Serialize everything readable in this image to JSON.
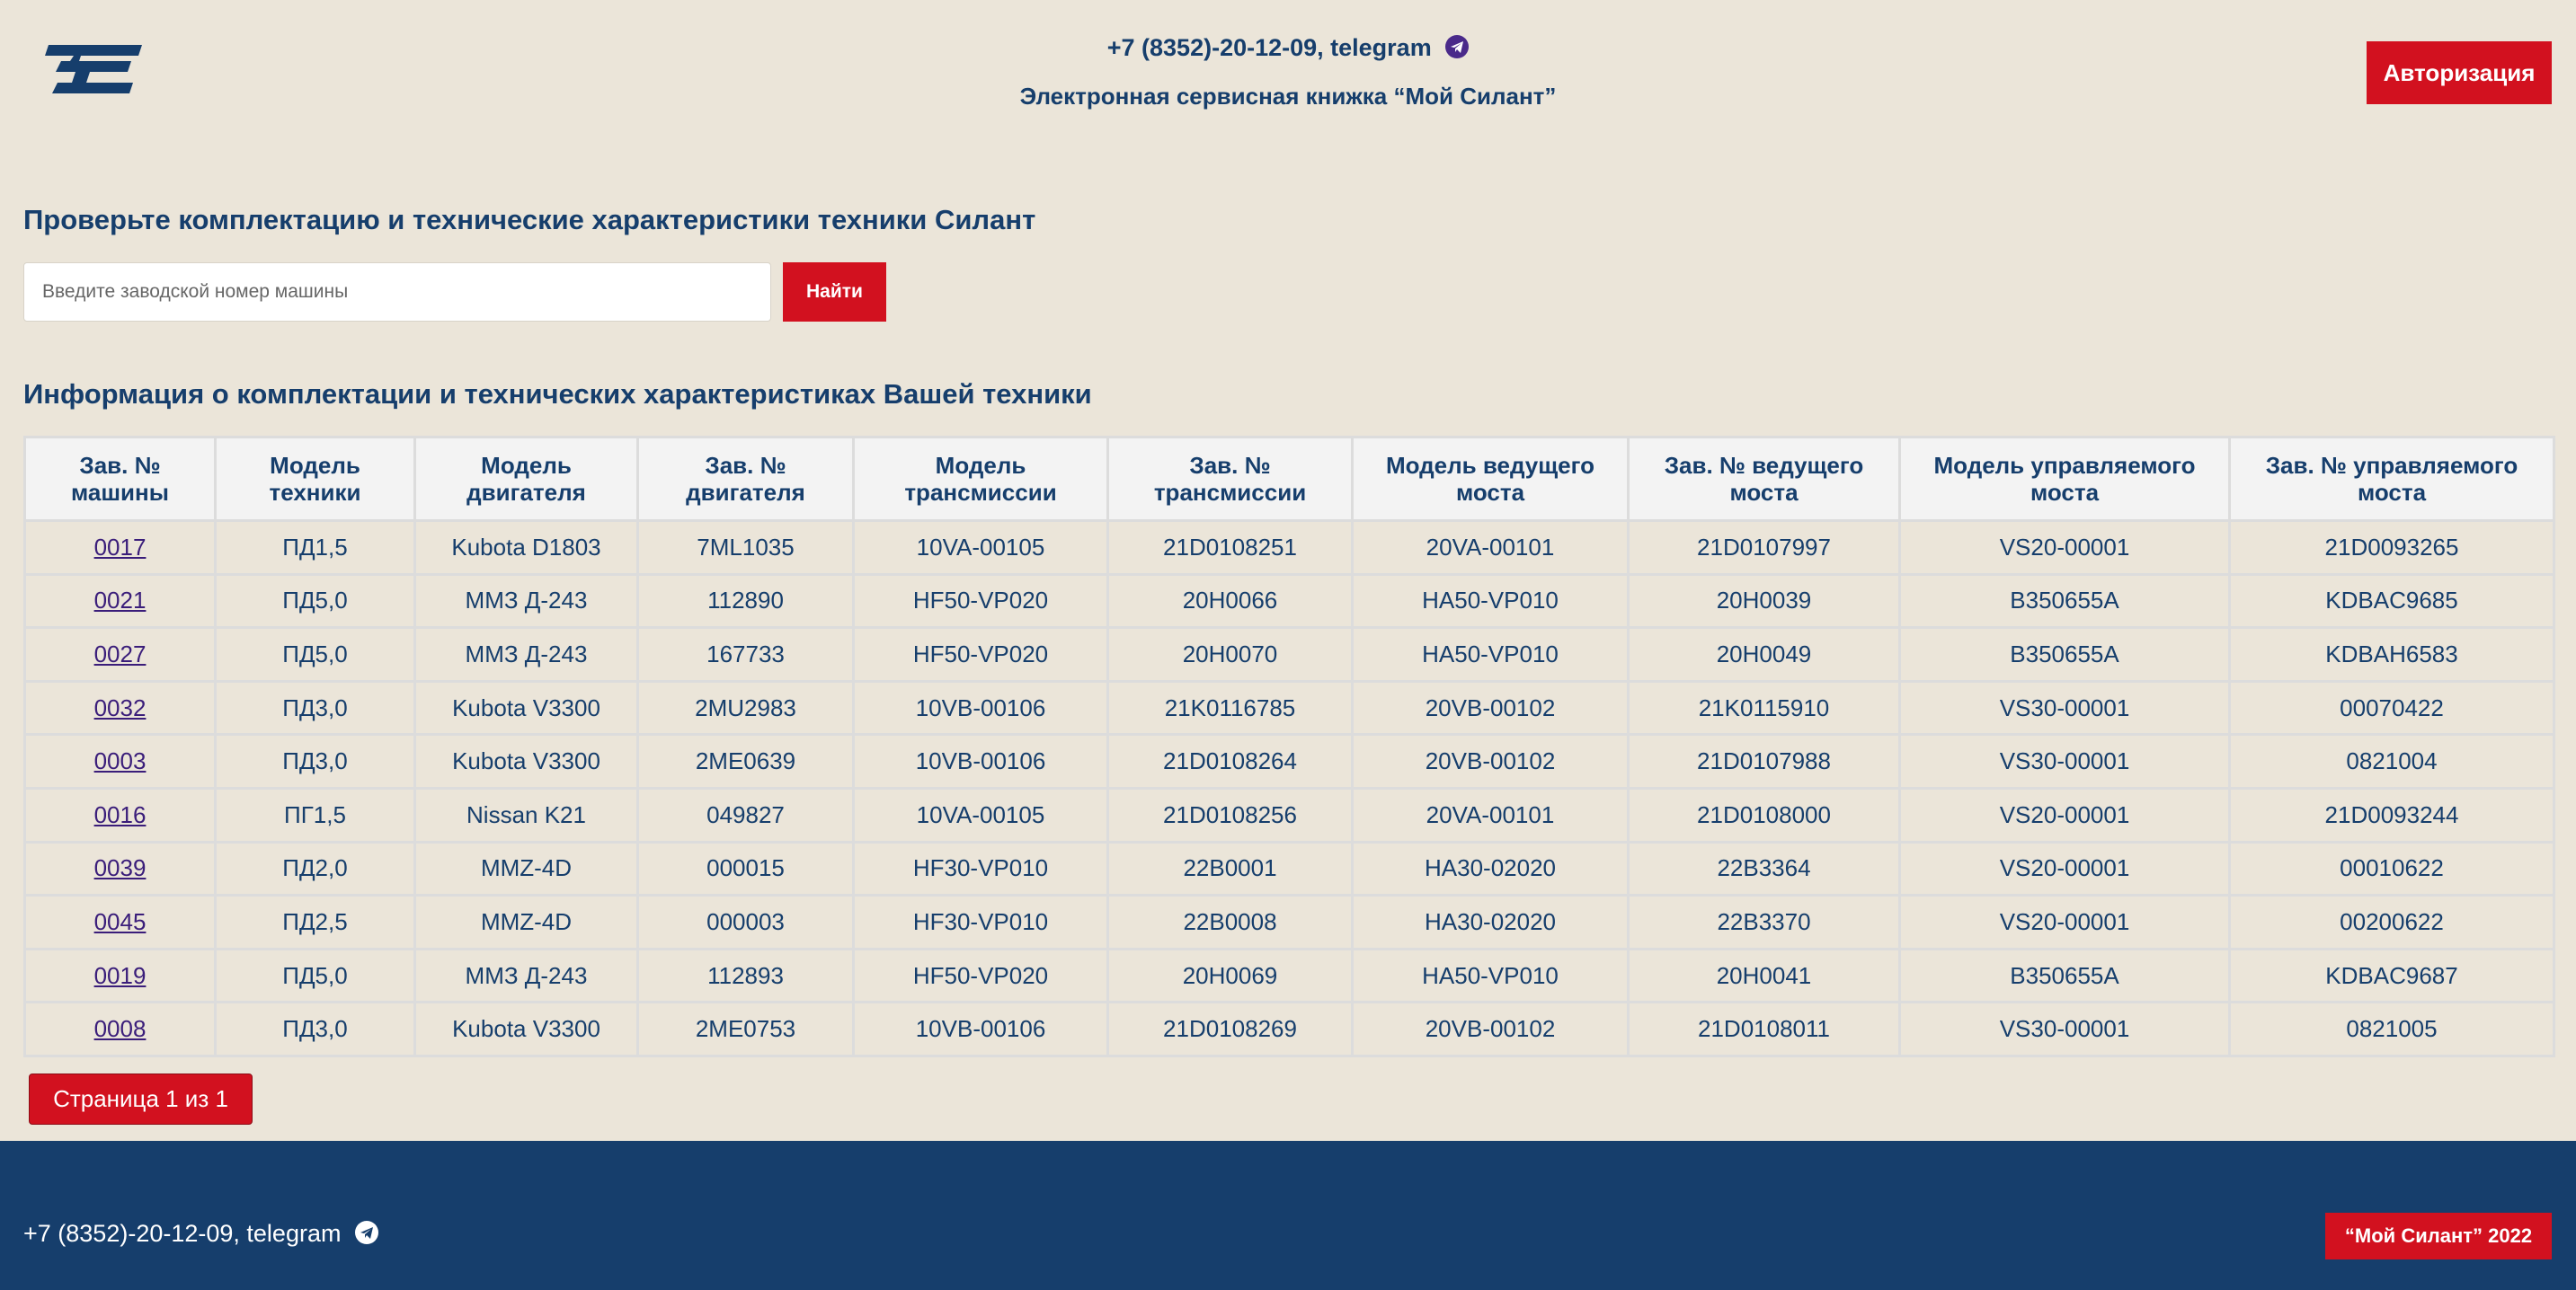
{
  "header": {
    "contact_text": "+7 (8352)-20-12-09, telegram",
    "subtitle": "Электронная сервисная книжка “Мой Силант”",
    "auth_button": "Авторизация",
    "brand_color": "#163e6c",
    "accent_color": "#d2111f"
  },
  "search": {
    "title": "Проверьте комплектацию и технические характеристики техники Силант",
    "placeholder": "Введите заводской номер машины",
    "button_label": "Найти"
  },
  "table": {
    "title": "Информация о комплектации и технических характеристиках Вашей техники",
    "headers": [
      [
        "Зав. №",
        "машины"
      ],
      [
        "Модель",
        "техники"
      ],
      [
        "Модель",
        "двигателя"
      ],
      [
        "Зав. №",
        "двигателя"
      ],
      [
        "Модель",
        "трансмиссии"
      ],
      [
        "Зав. №",
        "трансмиссии"
      ],
      [
        "Модель ведущего",
        "моста"
      ],
      [
        "Зав. № ведущего",
        "моста"
      ],
      [
        "Модель управляемого",
        "моста"
      ],
      [
        "Зав. № управляемого",
        "моста"
      ]
    ],
    "rows": [
      [
        "0017",
        "ПД1,5",
        "Kubota D1803",
        "7ML1035",
        "10VA-00105",
        "21D0108251",
        "20VA-00101",
        "21D0107997",
        "VS20-00001",
        "21D0093265"
      ],
      [
        "0021",
        "ПД5,0",
        "ММЗ Д-243",
        "112890",
        "HF50-VP020",
        "20H0066",
        "HA50-VP010",
        "20H0039",
        "B350655A",
        "KDBAC9685"
      ],
      [
        "0027",
        "ПД5,0",
        "ММЗ Д-243",
        "167733",
        "HF50-VP020",
        "20H0070",
        "HA50-VP010",
        "20H0049",
        "B350655A",
        "KDBAH6583"
      ],
      [
        "0032",
        "ПД3,0",
        "Kubota V3300",
        "2MU2983",
        "10VB-00106",
        "21K0116785",
        "20VB-00102",
        "21K0115910",
        "VS30-00001",
        "00070422"
      ],
      [
        "0003",
        "ПД3,0",
        "Kubota V3300",
        "2ME0639",
        "10VB-00106",
        "21D0108264",
        "20VB-00102",
        "21D0107988",
        "VS30-00001",
        "0821004"
      ],
      [
        "0016",
        "ПГ1,5",
        "Nissan K21",
        "049827",
        "10VA-00105",
        "21D0108256",
        "20VA-00101",
        "21D0108000",
        "VS20-00001",
        "21D0093244"
      ],
      [
        "0039",
        "ПД2,0",
        "MMZ-4D",
        "000015",
        "HF30-VP010",
        "22B0001",
        "HA30-02020",
        "22B3364",
        "VS20-00001",
        "00010622"
      ],
      [
        "0045",
        "ПД2,5",
        "MMZ-4D",
        "000003",
        "HF30-VP010",
        "22B0008",
        "HA30-02020",
        "22B3370",
        "VS20-00001",
        "00200622"
      ],
      [
        "0019",
        "ПД5,0",
        "ММЗ Д-243",
        "112893",
        "HF50-VP020",
        "20H0069",
        "HA50-VP010",
        "20H0041",
        "B350655A",
        "KDBAC9687"
      ],
      [
        "0008",
        "ПД3,0",
        "Kubota V3300",
        "2ME0753",
        "10VB-00106",
        "21D0108269",
        "20VB-00102",
        "21D0108011",
        "VS30-00001",
        "0821005"
      ]
    ],
    "pagination_label": "Страница 1 из 1"
  },
  "footer": {
    "contact_text": "+7 (8352)-20-12-09, telegram",
    "copyright": "“Мой Силант” 2022"
  },
  "icons": {
    "logo": "silant-logo-icon",
    "telegram": "telegram-icon"
  }
}
